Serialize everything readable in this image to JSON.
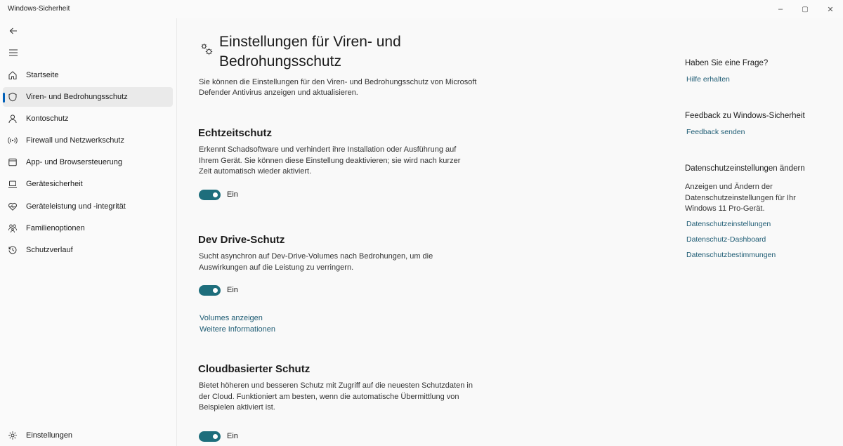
{
  "window": {
    "title": "Windows-Sicherheit",
    "controls": {
      "minimize": "–",
      "maximize": "▢",
      "close": "✕"
    }
  },
  "sidebar": {
    "items": [
      {
        "label": "Startseite",
        "icon": "home-icon"
      },
      {
        "label": "Viren- und Bedrohungsschutz",
        "icon": "shield-icon",
        "selected": true
      },
      {
        "label": "Kontoschutz",
        "icon": "person-icon"
      },
      {
        "label": "Firewall und Netzwerkschutz",
        "icon": "wireless-icon"
      },
      {
        "label": "App- und Browsersteuerung",
        "icon": "app-window-icon"
      },
      {
        "label": "Gerätesicherheit",
        "icon": "laptop-icon"
      },
      {
        "label": "Geräteleistung und -integrität",
        "icon": "heart-pulse-icon"
      },
      {
        "label": "Familienoptionen",
        "icon": "family-icon"
      },
      {
        "label": "Schutzverlauf",
        "icon": "history-icon"
      }
    ],
    "settings_label": "Einstellungen"
  },
  "main": {
    "title": "Einstellungen für Viren- und Bedrohungsschutz",
    "intro": "Sie können die Einstellungen für den Viren- und Bedrohungsschutz von Microsoft Defender Antivirus anzeigen und aktualisieren.",
    "sections": [
      {
        "title": "Echtzeitschutz",
        "description": "Erkennt Schadsoftware und verhindert ihre Installation oder Ausführung auf Ihrem Gerät. Sie können diese Einstellung deaktivieren; sie wird nach kurzer Zeit automatisch wieder aktiviert.",
        "toggle_on": true,
        "toggle_label": "Ein"
      },
      {
        "title": "Dev Drive-Schutz",
        "description": "Sucht asynchron auf Dev-Drive-Volumes nach Bedrohungen, um die Auswirkungen auf die Leistung zu verringern.",
        "toggle_on": true,
        "toggle_label": "Ein",
        "links": [
          "Volumes anzeigen",
          "Weitere Informationen"
        ]
      },
      {
        "title": "Cloudbasierter Schutz",
        "description": "Bietet höheren und besseren Schutz mit Zugriff auf die neuesten Schutzdaten in der Cloud. Funktioniert am besten, wenn die automatische Übermittlung von Beispielen aktiviert ist.",
        "toggle_on": true,
        "toggle_label": "Ein"
      }
    ]
  },
  "right_panel": {
    "question": {
      "heading": "Haben Sie eine Frage?",
      "link": "Hilfe erhalten"
    },
    "feedback": {
      "heading": "Feedback zu Windows-Sicherheit",
      "link": "Feedback senden"
    },
    "privacy": {
      "heading": "Datenschutzeinstellungen ändern",
      "text": "Anzeigen und Ändern der Datenschutzeinstellungen für Ihr Windows 11 Pro-Gerät.",
      "links": [
        "Datenschutzeinstellungen",
        "Datenschutz-Dashboard",
        "Datenschutzbestimmungen"
      ]
    }
  },
  "colors": {
    "accent": "#1e6e7c",
    "link": "#1e5c74",
    "nav_indicator": "#005fb8"
  }
}
